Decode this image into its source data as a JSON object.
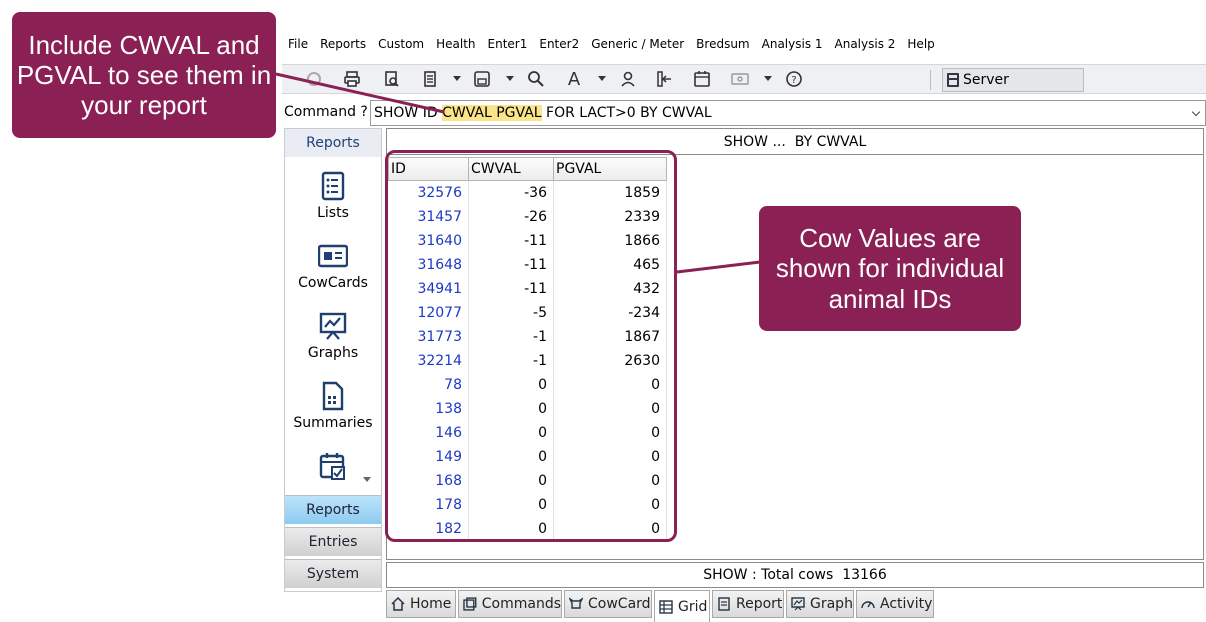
{
  "menu": [
    "File",
    "Reports",
    "Custom",
    "Health",
    "Enter1",
    "Enter2",
    "Generic / Meter",
    "Bredsum",
    "Analysis 1",
    "Analysis 2",
    "Help"
  ],
  "toolbar": {
    "server_label": "Server"
  },
  "command": {
    "label": "Command ?",
    "prefix": "SHOW ID ",
    "highlight": "CWVAL PGVAL",
    "suffix": " FOR LACT>0 BY CWVAL"
  },
  "left_panel": {
    "title": "Reports",
    "items": [
      {
        "label": "Lists",
        "icon": "list-icon"
      },
      {
        "label": "CowCards",
        "icon": "cowcard-icon"
      },
      {
        "label": "Graphs",
        "icon": "graph-icon"
      },
      {
        "label": "Summaries",
        "icon": "summary-icon"
      },
      {
        "label": "",
        "icon": "calendar-check-icon"
      }
    ],
    "nav": [
      {
        "label": "Reports",
        "active": true
      },
      {
        "label": "Entries",
        "active": false
      },
      {
        "label": "System",
        "active": false
      }
    ]
  },
  "report": {
    "title": "SHOW ...  BY CWVAL",
    "columns": [
      "ID",
      "CWVAL",
      "PGVAL"
    ],
    "rows": [
      [
        "32576",
        "-36",
        "1859"
      ],
      [
        "31457",
        "-26",
        "2339"
      ],
      [
        "31640",
        "-11",
        "1866"
      ],
      [
        "31648",
        "-11",
        "465"
      ],
      [
        "34941",
        "-11",
        "432"
      ],
      [
        "12077",
        "-5",
        "-234"
      ],
      [
        "31773",
        "-1",
        "1867"
      ],
      [
        "32214",
        "-1",
        "2630"
      ],
      [
        "78",
        "0",
        "0"
      ],
      [
        "138",
        "0",
        "0"
      ],
      [
        "146",
        "0",
        "0"
      ],
      [
        "149",
        "0",
        "0"
      ],
      [
        "168",
        "0",
        "0"
      ],
      [
        "178",
        "0",
        "0"
      ],
      [
        "182",
        "0",
        "0"
      ]
    ],
    "footer": "SHOW : Total cows  13166"
  },
  "tabs": [
    {
      "label": "Home",
      "icon": "home-icon",
      "active": false
    },
    {
      "label": "Commands",
      "icon": "commands-icon",
      "active": false
    },
    {
      "label": "CowCard",
      "icon": "cow-icon",
      "active": false
    },
    {
      "label": "Grid",
      "icon": "grid-icon",
      "active": true
    },
    {
      "label": "Report",
      "icon": "report-icon",
      "active": false
    },
    {
      "label": "Graph",
      "icon": "graph-icon",
      "active": false
    },
    {
      "label": "Activity",
      "icon": "activity-icon",
      "active": false
    }
  ],
  "callouts": {
    "include": "Include CWVAL and PGVAL to see them in your report",
    "cow_values": "Cow Values are shown for individual animal IDs"
  },
  "colors": {
    "callout": "#8b2054",
    "highlight": "#fbe58a",
    "id_link": "#1d39c4",
    "nav_active": "#9fd4f5"
  }
}
